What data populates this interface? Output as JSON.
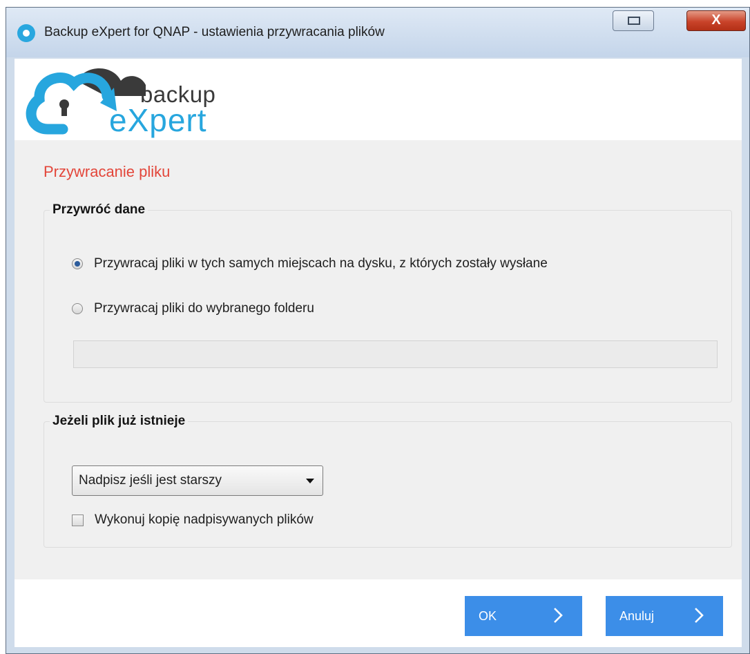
{
  "window": {
    "title": "Backup eXpert for QNAP - ustawienia przywracania plików",
    "close_label": "X"
  },
  "logo": {
    "line1": "backup",
    "line2": "eXpert",
    "colors": {
      "blue": "#27a6de",
      "gray": "#3a3a3a"
    }
  },
  "page": {
    "section_title": "Przywracanie pliku"
  },
  "restore_group": {
    "legend": "Przywróć dane",
    "option_same_location": "Przywracaj pliki w tych samych miejscach na dysku, z których zostały wysłane",
    "option_same_location_checked": true,
    "option_chosen_folder": "Przywracaj pliki do wybranego folderu",
    "option_chosen_folder_checked": false,
    "folder_path_value": ""
  },
  "exists_group": {
    "legend": "Jeżeli plik już istnieje",
    "overwrite_mode_selected": "Nadpisz jeśli jest starszy",
    "backup_overwritten_label": "Wykonuj kopię nadpisywanych plików",
    "backup_overwritten_checked": false
  },
  "buttons": {
    "ok_label": "OK",
    "cancel_label": "Anuluj",
    "accent_color": "#3c8ee8"
  },
  "icons": {
    "app": "app-cloud-icon",
    "restore": "restore-window-icon",
    "close": "close-icon",
    "chevron": "chevron-right-icon",
    "dropdown": "dropdown-arrow-icon"
  }
}
